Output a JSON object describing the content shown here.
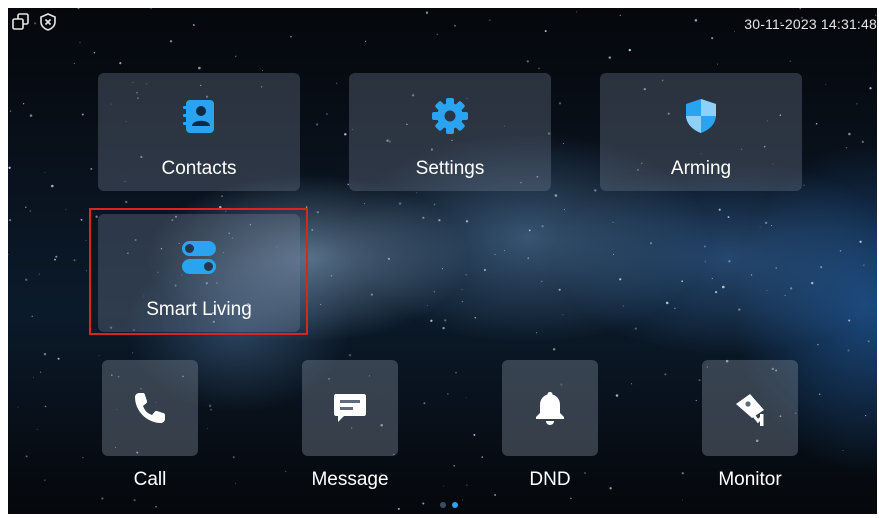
{
  "status_bar": {
    "datetime": "30-11-2023 14:31:48",
    "left_icons": [
      "window-restore-icon",
      "shield-x-icon"
    ]
  },
  "tiles": [
    {
      "label": "Contacts",
      "icon": "contacts-book-icon",
      "color": "#2aa3f0"
    },
    {
      "label": "Settings",
      "icon": "gear-icon",
      "color": "#2aa3f0"
    },
    {
      "label": "Arming",
      "icon": "shield-icon",
      "color": "#2aa3f0"
    },
    {
      "label": "Smart Living",
      "icon": "toggle-switches-icon",
      "color": "#2aa3f0",
      "highlighted": true
    }
  ],
  "dock": [
    {
      "label": "Call",
      "icon": "phone-icon"
    },
    {
      "label": "Message",
      "icon": "message-bubble-icon"
    },
    {
      "label": "DND",
      "icon": "bell-icon"
    },
    {
      "label": "Monitor",
      "icon": "cctv-camera-icon"
    }
  ],
  "pagination": {
    "pages": 2,
    "current": 2
  },
  "colors": {
    "accent": "#2aa3f0",
    "highlight_border": "#d8261c",
    "text": "#ffffff"
  }
}
